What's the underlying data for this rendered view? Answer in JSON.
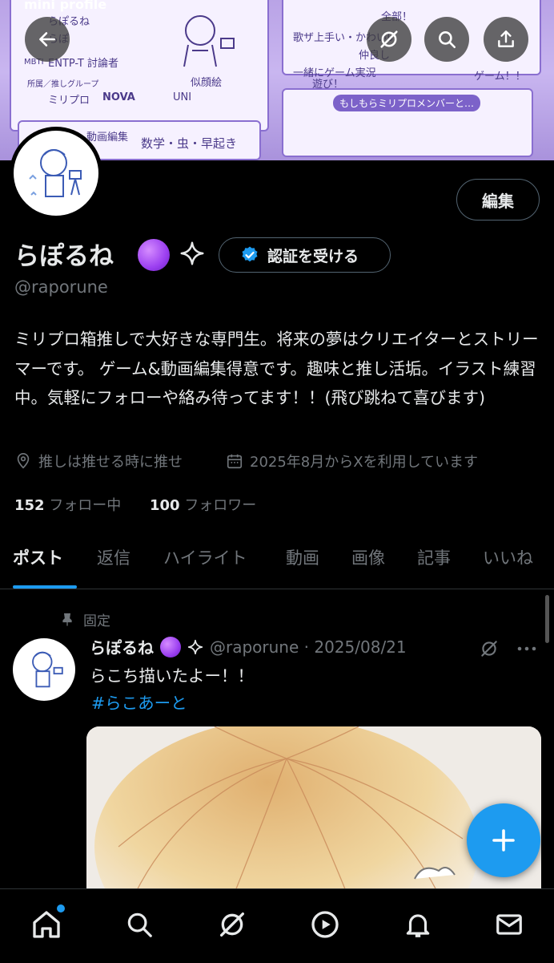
{
  "banner": {
    "heading": "mini profile",
    "lines": [
      "らぽるね",
      "らぽ",
      "ENTP-T 討論者",
      "ミリプロ",
      "NOVA",
      "UNI",
      "似顔絵",
      "数学・虫・早起き",
      "動画編集",
      "全部！",
      "歌ザ上手い・かわいい",
      "仲良し",
      "一緒にゲーム実況",
      "遊び！",
      "ゲーム！！",
      "もしもらミリプロメンバーと…"
    ],
    "labels": [
      "MBTI",
      "所属／推しグループ"
    ]
  },
  "profile": {
    "name": "らぽるね",
    "handle": "@raporune",
    "edit_label": "編集",
    "verify_label": "認証を受ける",
    "bio": "ミリプロ箱推しで大好きな専門生。将来の夢はクリエイターとストリーマーです。 ゲーム&動画編集得意です。趣味と推し活垢。イラスト練習中。気軽にフォローや絡み待ってます！！(飛び跳ねて喜びます)",
    "location": "推しは推せる時に推せ",
    "joined": "2025年8月からXを利用しています",
    "following_count": "152",
    "following_label": "フォロー中",
    "followers_count": "100",
    "followers_label": "フォロワー"
  },
  "tabs": [
    "ポスト",
    "返信",
    "ハイライト",
    "動画",
    "画像",
    "記事",
    "いいね"
  ],
  "post": {
    "pinned_label": "固定",
    "author": "らぽるね",
    "handle_date": "@raporune · 2025/08/21",
    "text": "らこち描いたよー！！",
    "hashtag": "#らこあーと"
  },
  "icons": {
    "back": "back-arrow-icon",
    "grok": "grok-icon",
    "search": "search-icon",
    "share": "share-icon",
    "home": "home-icon",
    "notifications": "bell-icon",
    "messages": "mail-icon",
    "video": "play-icon",
    "compose": "plus-icon"
  },
  "colors": {
    "accent": "#1d9bf0",
    "background": "#000000",
    "muted_text": "#71767b"
  }
}
